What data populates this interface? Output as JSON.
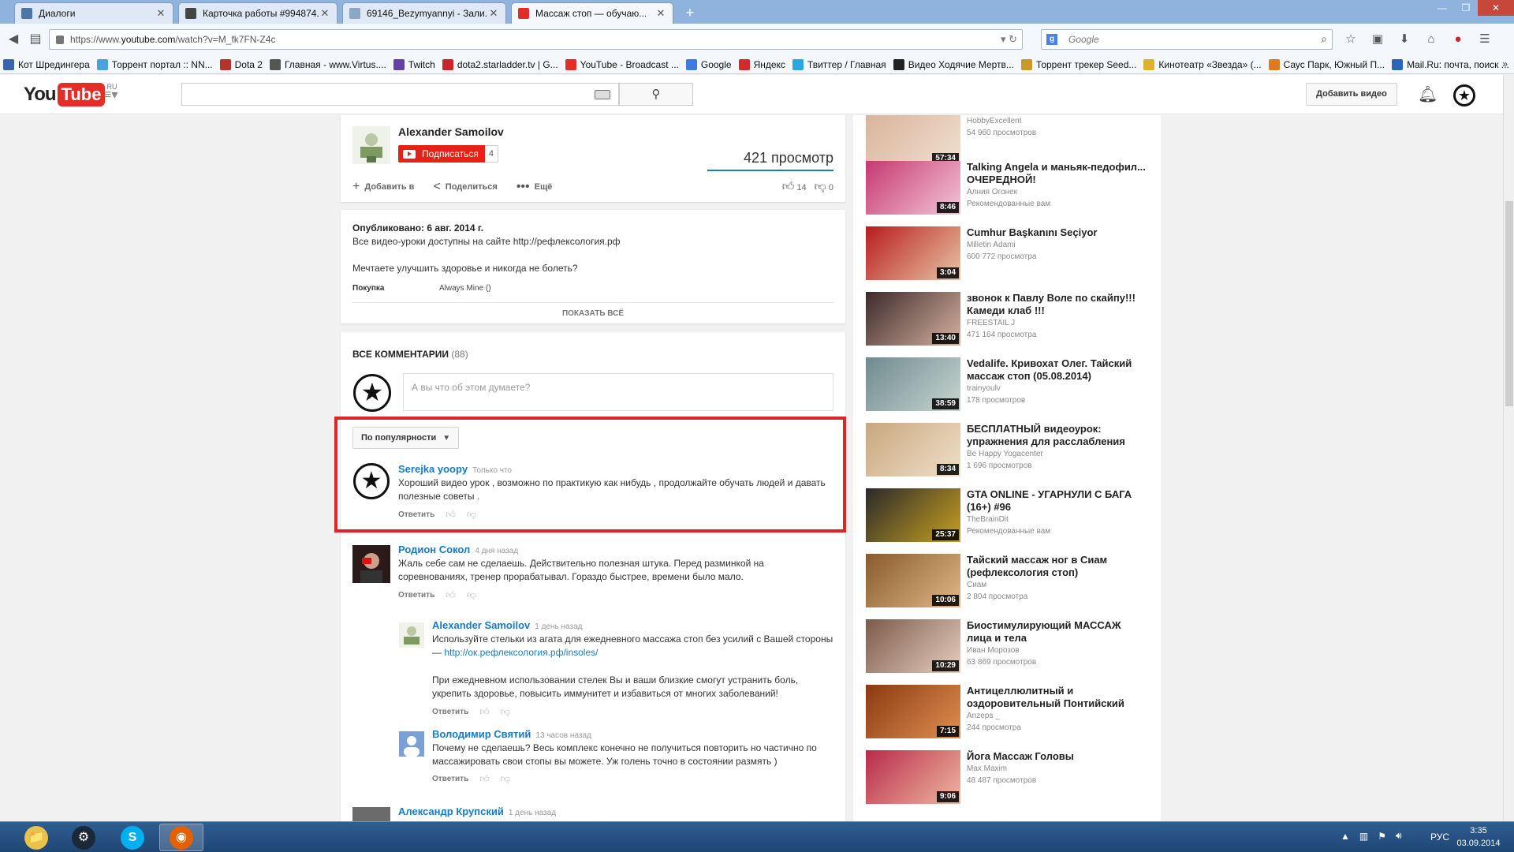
{
  "browser": {
    "tabs": [
      {
        "label": "Диалоги",
        "color": "#4a76a8"
      },
      {
        "label": "Карточка работы #994874...",
        "color": "#444444"
      },
      {
        "label": "69146_Bezymyannyi - Зали...",
        "color": "#8aa7c4"
      },
      {
        "label": "Массаж стоп — обучаю...",
        "color": "#e52d27",
        "active": true
      }
    ],
    "url_prefix": "https://www.",
    "url_host": "youtube.com",
    "url_path": "/watch?v=M_fk7FN-Z4c",
    "search_placeholder": "Google",
    "bookmarks": [
      {
        "label": "Кот Шредингера",
        "color": "#3b64b0"
      },
      {
        "label": "Торрент портал :: NN...",
        "color": "#4aa3df"
      },
      {
        "label": "Dota 2",
        "color": "#b5332a"
      },
      {
        "label": "Главная - www.Virtus....",
        "color": "#555555"
      },
      {
        "label": "Twitch",
        "color": "#6441a5"
      },
      {
        "label": "dota2.starladder.tv | G...",
        "color": "#c9252b"
      },
      {
        "label": "YouTube - Broadcast ...",
        "color": "#e52d27"
      },
      {
        "label": "Google",
        "color": "#3d7ae0"
      },
      {
        "label": "Яндекс",
        "color": "#d22b2b"
      },
      {
        "label": "Твиттер / Главная",
        "color": "#2da7e0"
      },
      {
        "label": "Видео Ходячие Мертв...",
        "color": "#222222"
      },
      {
        "label": "Торрент трекер Seed...",
        "color": "#c79a2a"
      },
      {
        "label": "Кинотеатр «Звезда» (...",
        "color": "#e0b12a"
      },
      {
        "label": "Саус Парк, Южный П...",
        "color": "#e07a20"
      },
      {
        "label": "Mail.Ru: почта, поиск ...",
        "color": "#2a66b8"
      }
    ],
    "bookmarks_more": "»"
  },
  "yt": {
    "logo_you": "You",
    "logo_tube": "Tube",
    "logo_region": "RU",
    "upload_label": "Добавить видео",
    "owner": {
      "name": "Alexander Samoilov",
      "subscribe_label": "Подписаться",
      "subscribe_count": "4",
      "views": "421 просмотр"
    },
    "actions": {
      "add": "Добавить в",
      "share": "Поделиться",
      "more": "Ещё",
      "likes": "14",
      "dislikes": "0"
    },
    "description": {
      "published": "Опубликовано: 6 авг. 2014 г.",
      "line1": "Все видео-уроки доступны на сайте http://рефлексология.рф",
      "line2": "Мечтаете улучшить здоровье и никогда не болеть?",
      "purchase_label": "Покупка",
      "purchase_value": "Always Mine ()",
      "show_all": "ПОКАЗАТЬ ВСЁ"
    },
    "comments": {
      "header": "ВСЕ КОММЕНТАРИИ",
      "count": "(88)",
      "placeholder": "А вы что об этом думаете?",
      "sort_label": "По популярности",
      "reply_label": "Ответить",
      "items": [
        {
          "author": "Serejka yoopy",
          "time": "Только что",
          "text": "Хороший видео урок , возможно по практикую как нибудь , продолжайте обучать людей и давать полезные советы ."
        },
        {
          "author": "Родион Сокол",
          "time": "4 дня назад",
          "text": "Жаль себе сам не сделаешь. Действительно полезная штука. Перед разминкой на соревнованиях, тренер прорабатывал. Гораздо быстрее, времени было мало."
        },
        {
          "author": "Alexander Samoilov",
          "time": "1 день назад",
          "text": "Используйте стельки из агата для ежедневного массажа стоп без усилий с Вашей стороны — ",
          "link": "http://ок.рефлексология.рф/insoles/",
          "text2": "При ежедневном использовании стелек Вы и ваши близкие смогут устранить боль, укрепить здоровье, повысить иммунитет и избавиться от многих заболеваний!"
        },
        {
          "author": "Володимир Святий",
          "time": "13 часов назад",
          "text": "Почему не сделаешь? Весь комплекс конечно не получиться повторить но частично по массажировать свои стопы  вы можете. Уж голень точно в состоянии размять )"
        },
        {
          "author": "Александр Крупский",
          "time": "1 день назад"
        }
      ]
    }
  },
  "sidebar": {
    "videos": [
      {
        "title": "",
        "channel": "HobbyExcellent",
        "views": "54 960 просмотров",
        "duration": "57:34",
        "c1": "#d9b39a",
        "c2": "#f0e0d0"
      },
      {
        "title": "Talking Angela и маньяк-педофил... ОЧЕРЕДНОЙ!",
        "channel": "Алния Огонек",
        "views": "Рекомендованные вам",
        "duration": "8:46",
        "c1": "#c5396f",
        "c2": "#f4c6d8"
      },
      {
        "title": "Cumhur Başkanını Seçiyor",
        "channel": "Milletin Adami",
        "views": "600 772 просмотра",
        "duration": "3:04",
        "c1": "#b81c1c",
        "c2": "#e8c6a6"
      },
      {
        "title": "звонок к Павлу Воле по скайпу!!! Камеди клаб !!!",
        "channel": "FREESTAIL J",
        "views": "471 164 просмотра",
        "duration": "13:40",
        "c1": "#3c2a2a",
        "c2": "#d6b2a0"
      },
      {
        "title": "Vedalife. Кривохат Олег. Тайский массаж стоп (05.08.2014)",
        "channel": "trainyoulv",
        "views": "178 просмотров",
        "duration": "38:59",
        "c1": "#6e8a8f",
        "c2": "#c9d6cf"
      },
      {
        "title": "БЕСПЛАТНЫЙ видеоурок: упражнения для расслабления",
        "channel": "Be Happy Yogacenter",
        "views": "1 696 просмотров",
        "duration": "8:34",
        "c1": "#c9a77e",
        "c2": "#efe0c8"
      },
      {
        "title": "GTA ONLINE - УГАРНУЛИ С БАГА (16+) #96",
        "channel": "TheBrainDit",
        "views": "Рекомендованные вам",
        "duration": "25:37",
        "c1": "#2a2a2a",
        "c2": "#c8a020"
      },
      {
        "title": "Тайский массаж ног в Сиам (рефлексология стоп)",
        "channel": "Сиам",
        "views": "2 804 просмотра",
        "duration": "10:06",
        "c1": "#8a5a2a",
        "c2": "#e0b888"
      },
      {
        "title": "Биостимулирующий МАССАЖ лица и тела",
        "channel": "Иван Морозов",
        "views": "63 869 просмотров",
        "duration": "10:29",
        "c1": "#7c5a4a",
        "c2": "#e6cfc0"
      },
      {
        "title": "Антицеллюлитный и оздоровительный Понтийский",
        "channel": "Anzeps _",
        "views": "244 просмотра",
        "duration": "7:15",
        "c1": "#8a3a10",
        "c2": "#e09050"
      },
      {
        "title": "Йога Массаж Головы",
        "channel": "Max Maxim",
        "views": "48 487 просмотров",
        "duration": "9:06",
        "c1": "#b82a4a",
        "c2": "#f0b8a0"
      }
    ]
  },
  "taskbar": {
    "apps": [
      {
        "name": "explorer",
        "color": "#e8c24a"
      },
      {
        "name": "steam",
        "color": "#1b2838"
      },
      {
        "name": "skype",
        "color": "#00aff0"
      },
      {
        "name": "firefox",
        "color": "#e66000",
        "active": true
      }
    ],
    "lang": "РУС",
    "time": "3:35",
    "date": "03.09.2014"
  }
}
